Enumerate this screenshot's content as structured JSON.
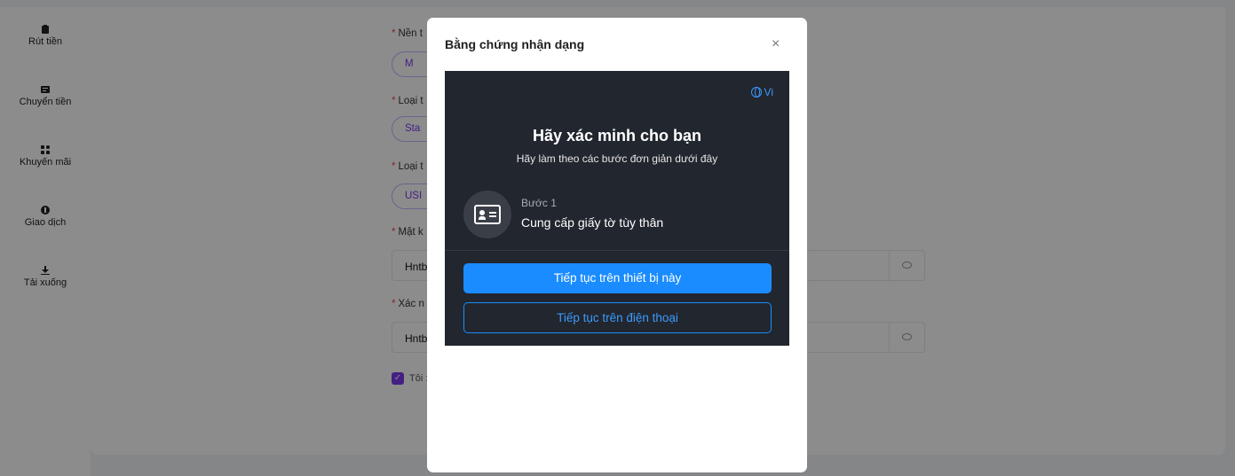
{
  "sidebar": {
    "items": [
      {
        "label": "Rút tiền",
        "icon": "wallet-icon"
      },
      {
        "label": "Chuyển tiền",
        "icon": "transfer-icon"
      },
      {
        "label": "Khuyến mãi",
        "icon": "grid-icon"
      },
      {
        "label": "Giao dịch",
        "icon": "dollar-icon"
      },
      {
        "label": "Tải xuống",
        "icon": "download-icon"
      }
    ]
  },
  "form": {
    "platform_label": "Nền t",
    "platform_chip": "M",
    "account_type_label": "Loại t",
    "account_type_chip": "Sta",
    "currency_label": "Loại t",
    "currency_chip": "USI",
    "password_label": "Mật k",
    "password_value": "Hntb",
    "confirm_label": "Xác n",
    "confirm_value": "Hntb",
    "agree_label": "Tôi :"
  },
  "modal": {
    "title": "Bằng chứng nhận dạng",
    "close_symbol": "×",
    "verify": {
      "language": "Vi",
      "title": "Hãy xác minh cho bạn",
      "subtitle": "Hãy làm theo các bước đơn giản dưới đây",
      "step_number": "Bước 1",
      "step_text": "Cung cấp giấy tờ tùy thân",
      "primary_button": "Tiếp tục trên thiết bị này",
      "secondary_button": "Tiếp tục trên điện thoại"
    }
  },
  "colors": {
    "accent": "#1a8cff",
    "brand_purple": "#7c3aed",
    "verify_bg": "#22262e"
  }
}
